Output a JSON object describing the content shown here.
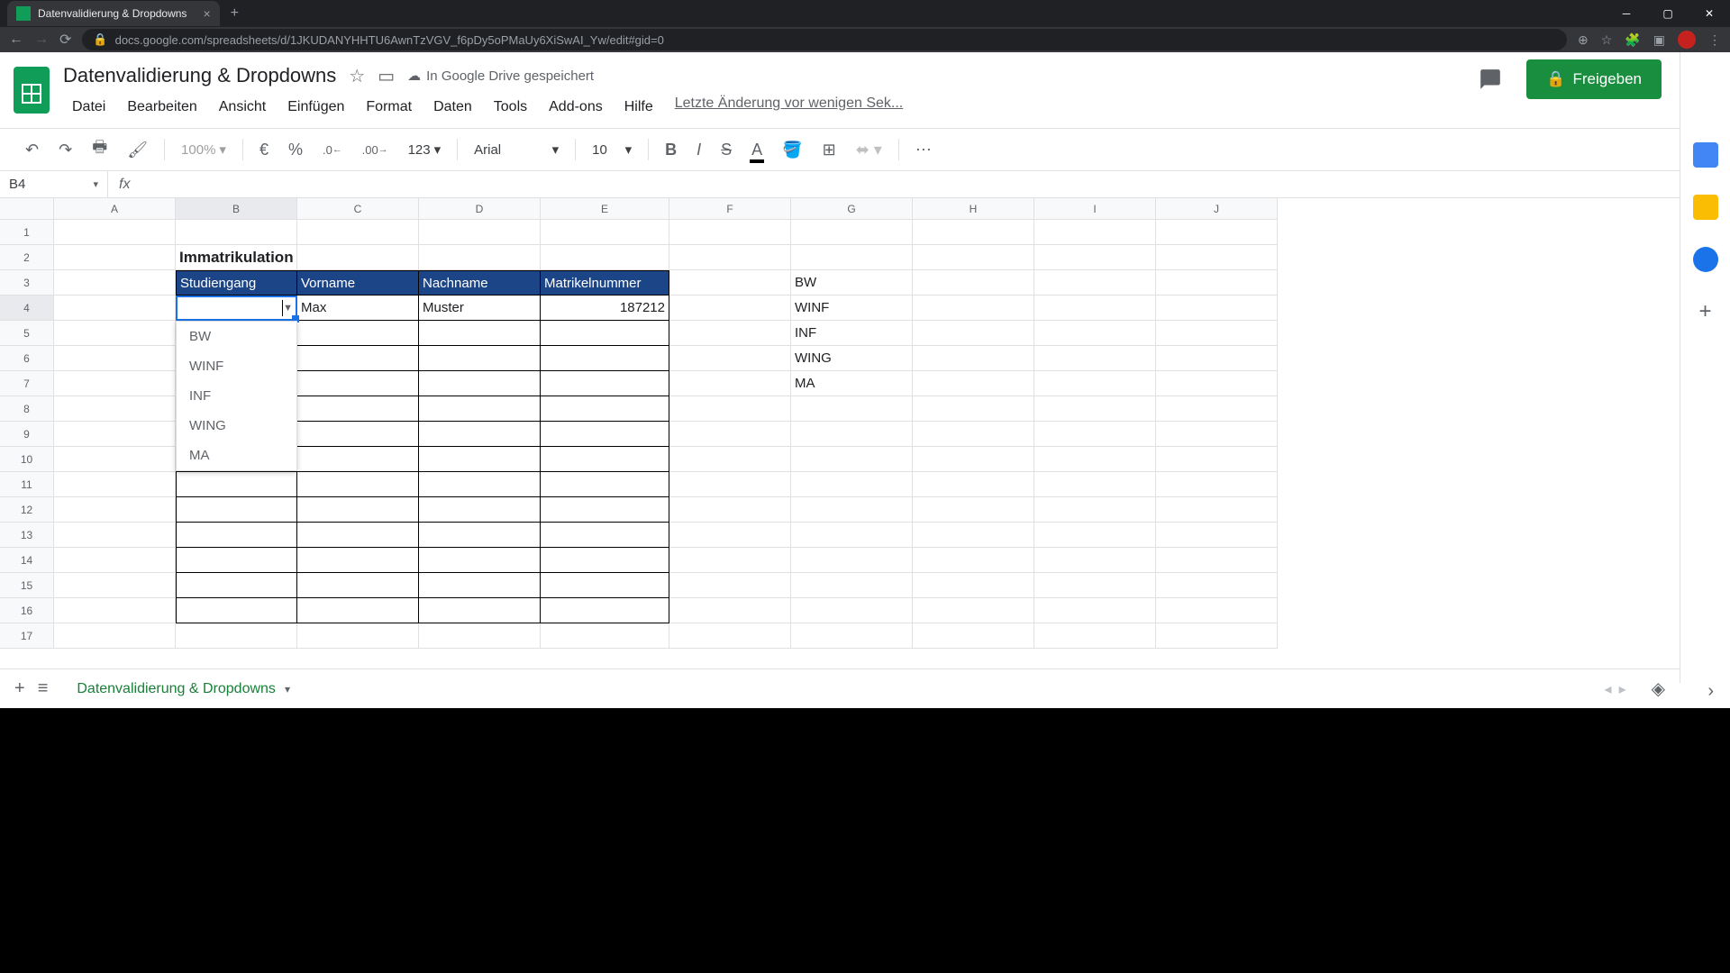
{
  "browser": {
    "tab_title": "Datenvalidierung & Dropdowns",
    "url": "docs.google.com/spreadsheets/d/1JKUDANYHHTU6AwnTzVGV_f6pDy5oPMaUy6XiSwAI_Yw/edit#gid=0"
  },
  "doc": {
    "title": "Datenvalidierung & Dropdowns",
    "save_status": "In Google Drive gespeichert",
    "menus": [
      "Datei",
      "Bearbeiten",
      "Ansicht",
      "Einfügen",
      "Format",
      "Daten",
      "Tools",
      "Add-ons",
      "Hilfe"
    ],
    "last_edit": "Letzte Änderung vor wenigen Sek...",
    "share_label": "Freigeben"
  },
  "toolbar": {
    "zoom": "100%",
    "currency": "€",
    "percent": "%",
    "dec_less": ".0",
    "dec_more": ".00",
    "format_btn": "123",
    "font": "Arial",
    "font_size": "10"
  },
  "namebox": {
    "ref": "B4"
  },
  "columns": [
    "A",
    "B",
    "C",
    "D",
    "E",
    "F",
    "G",
    "H",
    "I",
    "J"
  ],
  "row_count": 17,
  "table": {
    "title": "Immatrikulation",
    "headers": [
      "Studiengang",
      "Vorname",
      "Nachname",
      "Matrikelnummer"
    ],
    "row4": {
      "vorname": "Max",
      "nachname": "Muster",
      "matrikel": "187212"
    }
  },
  "dropdown_options": [
    "BW",
    "WINF",
    "INF",
    "WING",
    "MA"
  ],
  "g_list": [
    "BW",
    "WINF",
    "INF",
    "WING",
    "MA"
  ],
  "sheet_tab": "Datenvalidierung & Dropdowns"
}
